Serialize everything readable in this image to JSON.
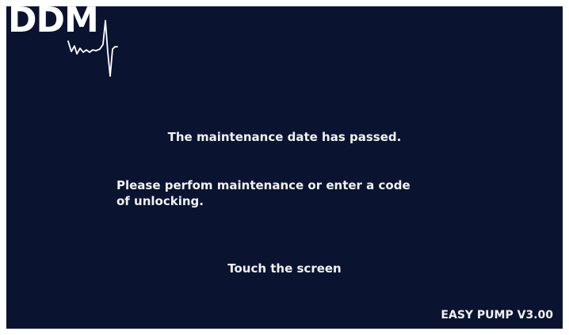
{
  "logo": {
    "text": "DDM",
    "icon": "heartbeat-pulse-icon"
  },
  "message": {
    "title": "The maintenance date has passed.",
    "body_line1": "Please perfom maintenance or enter a code",
    "body_line2": "of unlocking.",
    "touch_prompt": "Touch the screen"
  },
  "footer": {
    "version": "EASY PUMP V3.00"
  },
  "colors": {
    "background": "#0a1431",
    "text": "#f2f2f2",
    "border": "#ffffff"
  }
}
